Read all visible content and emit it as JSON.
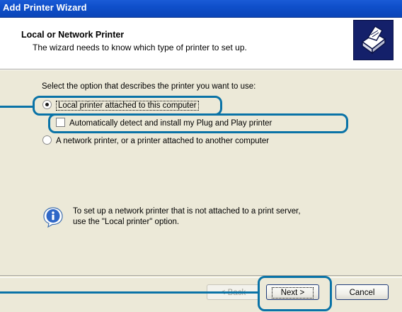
{
  "window": {
    "title": "Add Printer Wizard"
  },
  "header": {
    "title": "Local or Network Printer",
    "subtitle": "The wizard needs to know which type of printer to set up."
  },
  "body": {
    "intro": "Select the option that describes the printer you want to use:",
    "options": {
      "local_printer": {
        "label": "Local printer attached to this computer",
        "selected": true
      },
      "auto_detect": {
        "label": "Automatically detect and install my Plug and Play printer",
        "checked": false
      },
      "network_printer": {
        "label": "A network printer, or a printer attached to another computer",
        "selected": false
      }
    },
    "info": {
      "line1": "To set up a network printer that is not attached to a print server,",
      "line2": "use the \"Local printer\" option."
    }
  },
  "buttons": {
    "back": "< Back",
    "next": "Next >",
    "cancel": "Cancel"
  },
  "colors": {
    "highlight": "#0a73a7",
    "titlebar": "#0f4fca"
  },
  "icons": [
    "printer-icon",
    "info-icon"
  ]
}
